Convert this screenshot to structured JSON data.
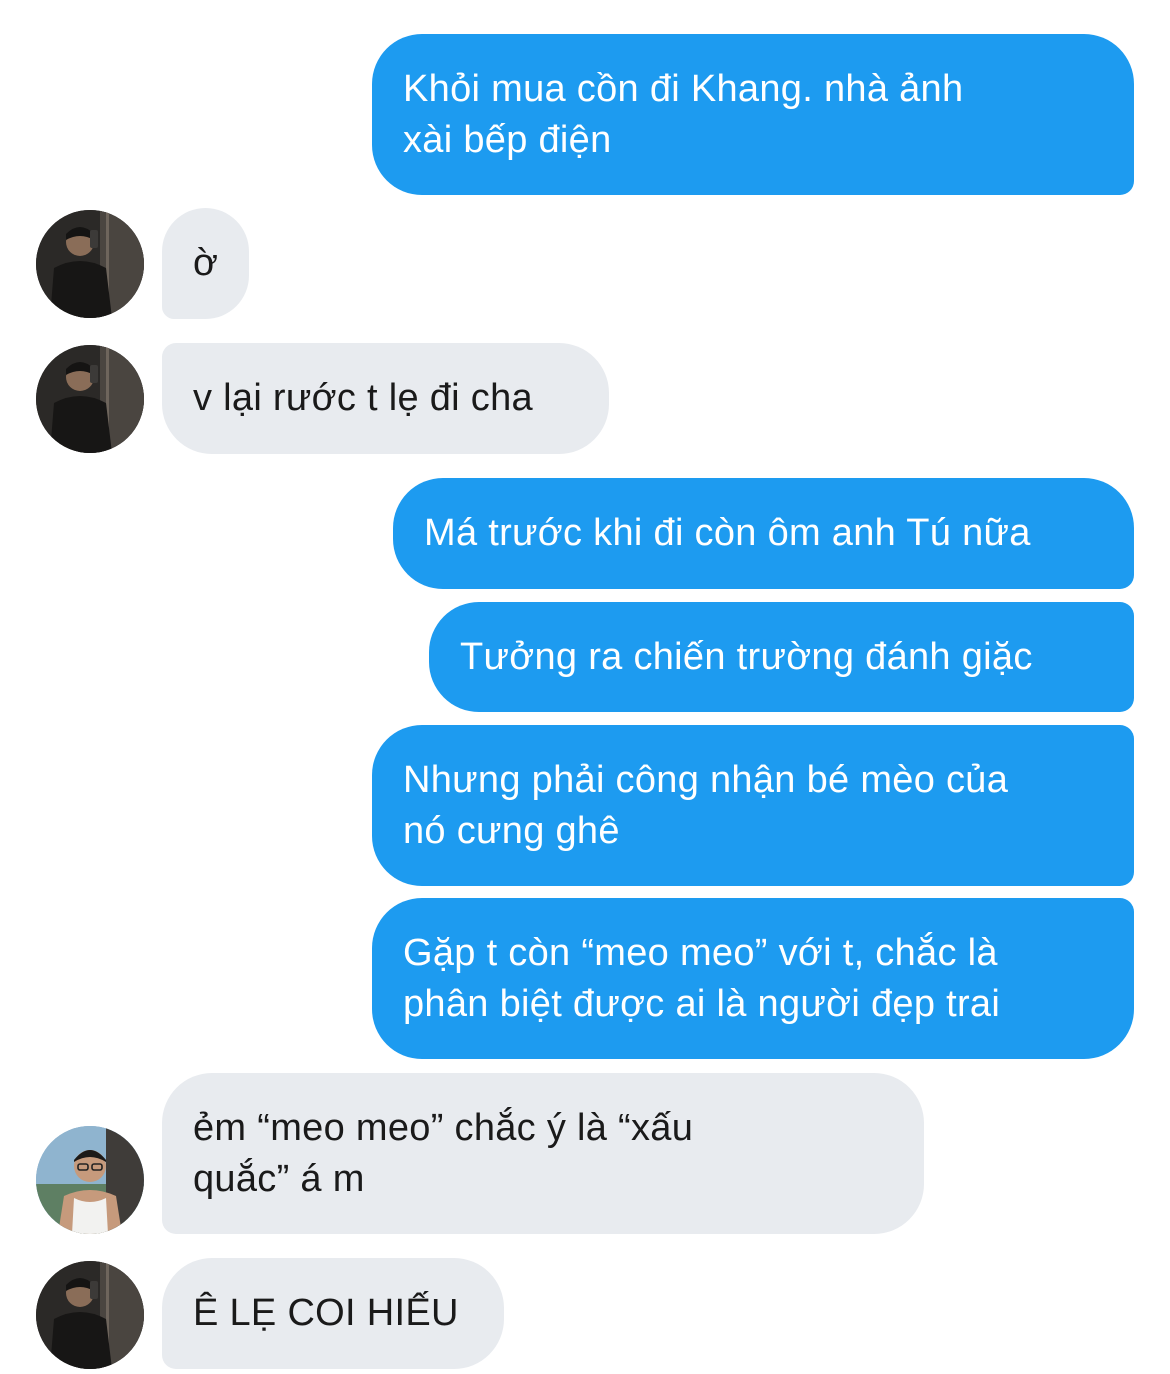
{
  "messages": [
    {
      "id": "m1",
      "direction": "outgoing",
      "text": "Khỏi mua cồn đi Khang. nhà ảnh\nxài bếp điện"
    },
    {
      "id": "m2",
      "direction": "incoming",
      "sender_avatar": "mirror-selfie-avatar",
      "text": "ờ"
    },
    {
      "id": "m3",
      "direction": "incoming",
      "sender_avatar": "mirror-selfie-avatar",
      "text": "v lại rước t lẹ đi cha"
    },
    {
      "id": "m4",
      "direction": "outgoing",
      "text": "Má trước khi đi còn ôm anh Tú nữa"
    },
    {
      "id": "m5",
      "direction": "outgoing",
      "text": "Tưởng ra chiến trường đánh giặc"
    },
    {
      "id": "m6",
      "direction": "outgoing",
      "text": "Nhưng phải công nhận bé mèo của\nnó cưng ghê"
    },
    {
      "id": "m7",
      "direction": "outgoing",
      "text": "Gặp t còn “meo meo” với t, chắc là\nphân biệt được ai là người đẹp trai"
    },
    {
      "id": "m8",
      "direction": "incoming",
      "sender_avatar": "glasses-tanktop-avatar",
      "text": "ẻm “meo meo” chắc ý là “xấu\nquắc” á m"
    },
    {
      "id": "m9",
      "direction": "incoming",
      "sender_avatar": "mirror-selfie-avatar",
      "text": "Ê LẸ COI HIẾU"
    }
  ],
  "colors": {
    "outgoing_bubble": "#1d9bf0",
    "incoming_bubble": "#e8ebef",
    "outgoing_text": "#ffffff",
    "incoming_text": "#1a1a1a"
  }
}
